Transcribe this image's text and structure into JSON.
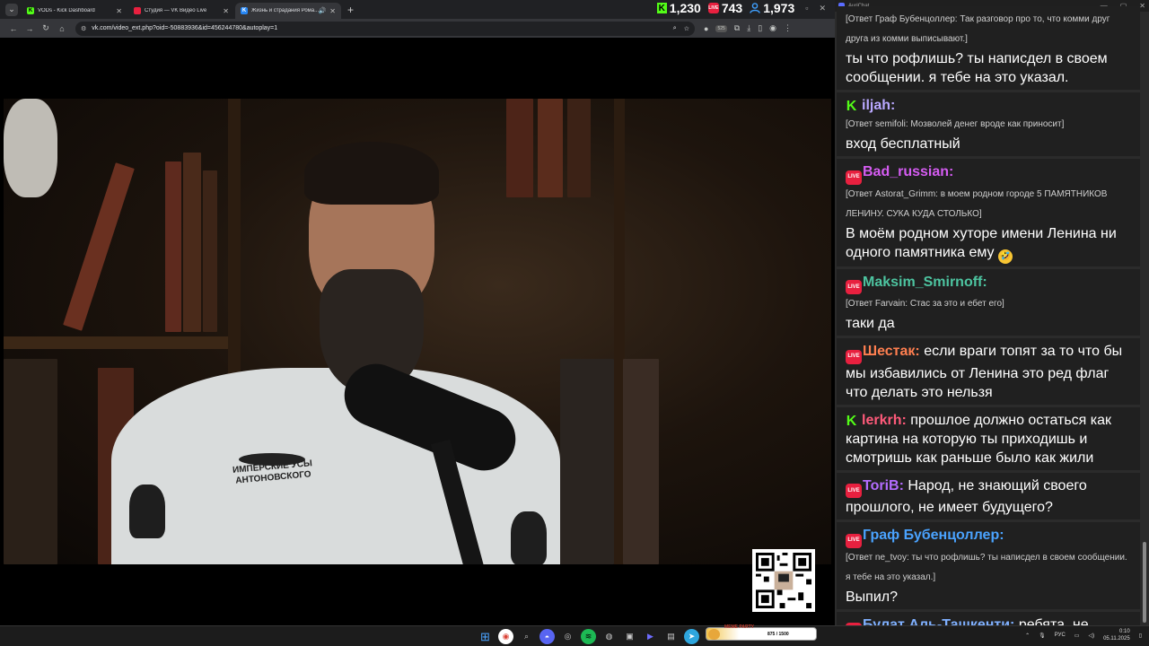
{
  "browser": {
    "tabs": [
      {
        "title": "VODs - Kick Dashboard",
        "favicon": "kick-icon",
        "color": "#53fc18"
      },
      {
        "title": "Студия — VK Видео Live",
        "favicon": "vk-live-icon",
        "color": "#e8203f"
      },
      {
        "title": "Жизнь и страдания Рома...",
        "favicon": "vk-icon",
        "color": "#2787f5"
      }
    ],
    "url": "vk.com/video_ext.php?oid=-50883936&id=456244780&autoplay=1",
    "extension_badge": "525"
  },
  "viewer_stats": {
    "kick": "1,230",
    "vk": "743",
    "total": "1,973"
  },
  "video": {
    "brand_line1": "ИМПЕРСКИЕ УСЫ",
    "brand_line2": "АНТОНОВСКОГО"
  },
  "chat": {
    "app_title": "AuriChat",
    "messages": [
      {
        "badge": "",
        "user": "",
        "reply": "[Ответ Граф Бубенцоллер: Так разговор про то, что комми друг друга из комми выписывают.]",
        "text": "ты что рофлишь? ты написдел в своем сообщении. я тебе на это указал.",
        "color": "#ffffff"
      },
      {
        "badge": "kick",
        "user": "iljah:",
        "reply": "[Ответ semifoli: Мозволей денег вроде как приносит]",
        "text": "вход бесплатный",
        "color": "#b9a8ff"
      },
      {
        "badge": "live",
        "user": "Bad_russian:",
        "reply": "[Ответ Astorat_Grimm: в моем родном городе 5 ПАМЯТНИКОВ ЛЕНИНУ. СУКА КУДА СТОЛЬКО]",
        "text": "В моём родном хуторе имени Ленина ни одного памятника ему",
        "emoji": "🤣",
        "color": "#d55cf2"
      },
      {
        "badge": "live",
        "user": "Maksim_Smirnoff:",
        "reply": "[Ответ Farvain: Стас за это и ебет его]",
        "text": "таки да",
        "color": "#4dc4a0"
      },
      {
        "badge": "live",
        "user": "Шестак:",
        "reply": "",
        "text": "если враги топят за то что бы мы избавились от Ленина это ред флаг что делать это нельзя",
        "color": "#ff7f50"
      },
      {
        "badge": "kick",
        "user": "lerkrh:",
        "reply": "",
        "text": "прошлое должно остаться как картина на которую ты приходишь и смотришь как раньше было как жили",
        "color": "#ff5a7a"
      },
      {
        "badge": "live",
        "user": "ToriB:",
        "reply": "",
        "text": "Народ, не знающий своего прошлого, не имеет будущего?",
        "color": "#b36cff"
      },
      {
        "badge": "live",
        "user": "Граф Бубенцоллер:",
        "reply": "[Ответ ne_tvoy: ты что рофлишь? ты написдел в своем сообщении. я тебе на это указал.]",
        "text": "Выпил?",
        "color": "#4aa3ff"
      },
      {
        "badge": "live",
        "user": "Булат Аль-Ташкенти:",
        "reply": "",
        "text": "ребята, не смотрел сначала, подскажите че это за человек?",
        "color": "#7fb0ff"
      }
    ]
  },
  "taskbar": {
    "meme_label": "MEME PARTY",
    "meme_progress": "875 / 1500",
    "lang": "РУС",
    "time": "0:10",
    "date": "05.11.2025"
  }
}
